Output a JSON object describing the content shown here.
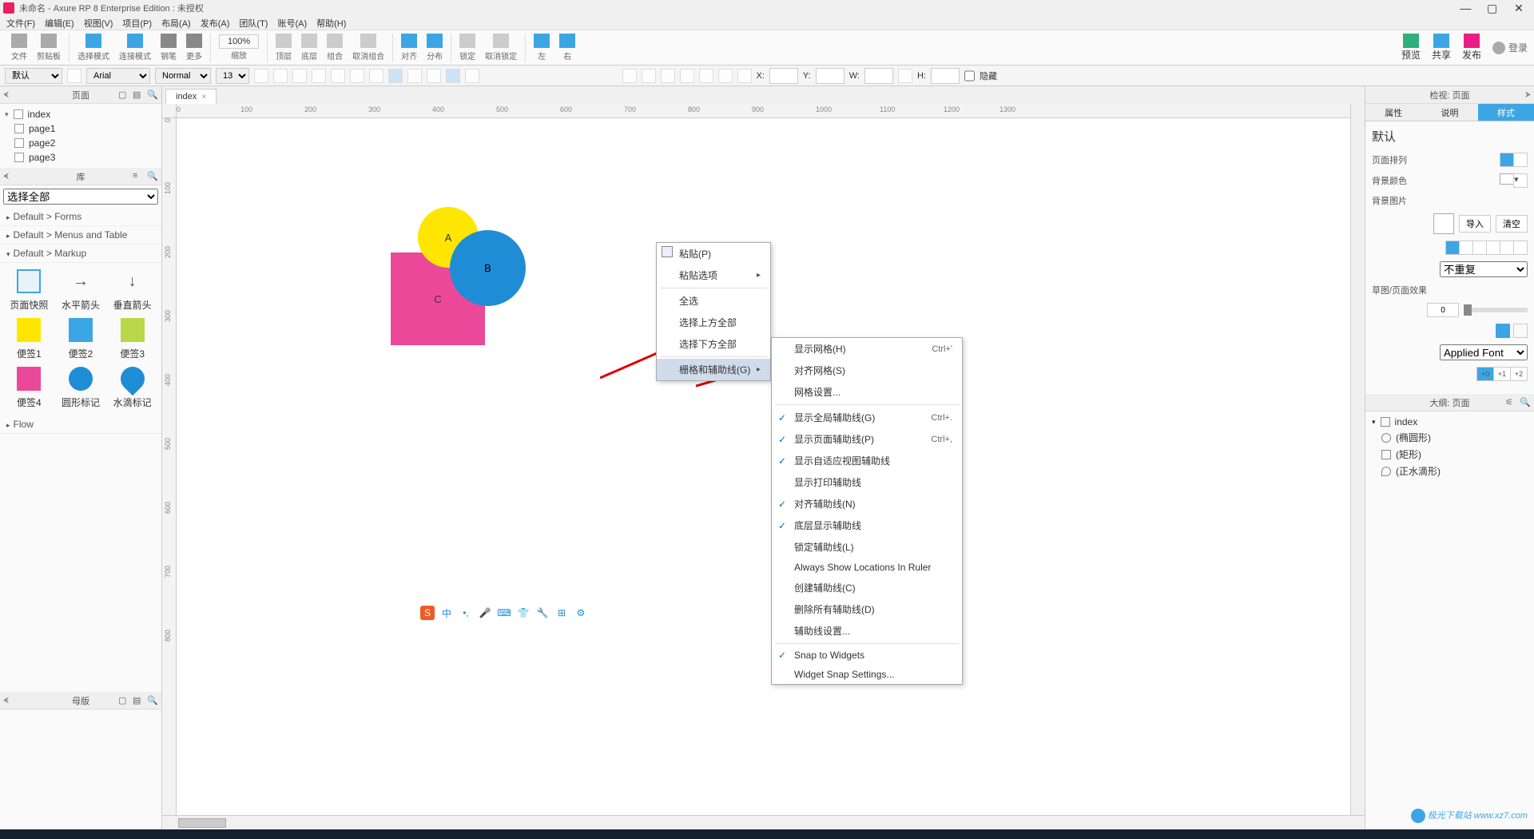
{
  "title": "未命名 - Axure RP 8 Enterprise Edition : 未授权",
  "menus": [
    "文件(F)",
    "编辑(E)",
    "视图(V)",
    "项目(P)",
    "布局(A)",
    "发布(A)",
    "团队(T)",
    "账号(A)",
    "帮助(H)"
  ],
  "toolbar": {
    "groups": [
      "文件",
      "剪贴板",
      "选择模式",
      "连接模式",
      "钢笔",
      "更多"
    ],
    "zoom": "100%",
    "zoomlbl": "缩放",
    "groups2": [
      "顶层",
      "底层",
      "组合",
      "取消组合",
      "对齐",
      "分布",
      "锁定",
      "取消锁定",
      "左",
      "右"
    ],
    "preview": "预览",
    "share": "共享",
    "publish": "发布",
    "login": "登录"
  },
  "propbar": {
    "style": "默认",
    "font": "Arial",
    "weight": "Normal",
    "size": "13",
    "x": "X:",
    "y": "Y:",
    "w": "W:",
    "h": "H:",
    "hidden": "隐藏"
  },
  "leftpanels": {
    "pages": "页面",
    "lib": "库",
    "master": "母版",
    "selectAll": "选择全部"
  },
  "pages": {
    "root": "index",
    "children": [
      "page1",
      "page2",
      "page3"
    ]
  },
  "libCats": [
    "Default > Forms",
    "Default > Menus and Table",
    "Default > Markup",
    "Flow"
  ],
  "libItems": [
    "页面快照",
    "水平箭头",
    "垂直箭头",
    "便签1",
    "便签2",
    "便签3",
    "便签4",
    "圆形标记",
    "水滴标记"
  ],
  "tab": "index",
  "shapes": {
    "a": "A",
    "b": "B",
    "c": "C"
  },
  "contextMenu1": {
    "paste": "粘贴(P)",
    "pasteOpt": "粘贴选项",
    "selectAll": "全选",
    "selectAbove": "选择上方全部",
    "selectBelow": "选择下方全部",
    "gridGuides": "栅格和辅助线(G)"
  },
  "contextMenu2": {
    "showGrid": "显示网格(H)",
    "snapGrid": "对齐网格(S)",
    "gridSettings": "网格设置...",
    "showGlobal": "显示全局辅助线(G)",
    "showPage": "显示页面辅助线(P)",
    "showAdaptive": "显示自适应视图辅助线",
    "showPrint": "显示打印辅助线",
    "snapGuides": "对齐辅助线(N)",
    "showBack": "底层显示辅助线",
    "lockGuides": "锁定辅助线(L)",
    "alwaysLoc": "Always Show Locations In Ruler",
    "createGuides": "创建辅助线(C)",
    "deleteGuides": "删除所有辅助线(D)",
    "guideSettings": "辅助线设置...",
    "snapWidgets": "Snap to Widgets",
    "widgetSnap": "Widget Snap Settings...",
    "sc1": "Ctrl+'",
    "sc2": "Ctrl+.",
    "sc3": "Ctrl+,"
  },
  "rightpanels": {
    "inspector": "检视: 页面",
    "outline": "大纲: 页面"
  },
  "inspTabs": [
    "属性",
    "说明",
    "样式"
  ],
  "inspector": {
    "defaultStyle": "默认",
    "pageAlign": "页面排列",
    "bgColor": "背景颜色",
    "bgImage": "背景图片",
    "import": "导入",
    "clear": "清空",
    "noRepeat": "不重复",
    "sketch": "草图/页面效果",
    "sketchVal": "0",
    "font": "Applied Font",
    "fontSize": [
      "+0",
      "+1",
      "+2"
    ]
  },
  "outline": {
    "root": "index",
    "items": [
      "(椭圆形)",
      "(矩形)",
      "(正水滴形)"
    ]
  },
  "rulerH": [
    "0",
    "100",
    "200",
    "300",
    "400",
    "500",
    "600",
    "700",
    "800",
    "900",
    "1000",
    "1100",
    "1200",
    "1300"
  ],
  "rulerV": [
    "0",
    "100",
    "200",
    "300",
    "400",
    "500",
    "600",
    "700",
    "800"
  ],
  "watermark": "极光下载站\nwww.xz7.com"
}
